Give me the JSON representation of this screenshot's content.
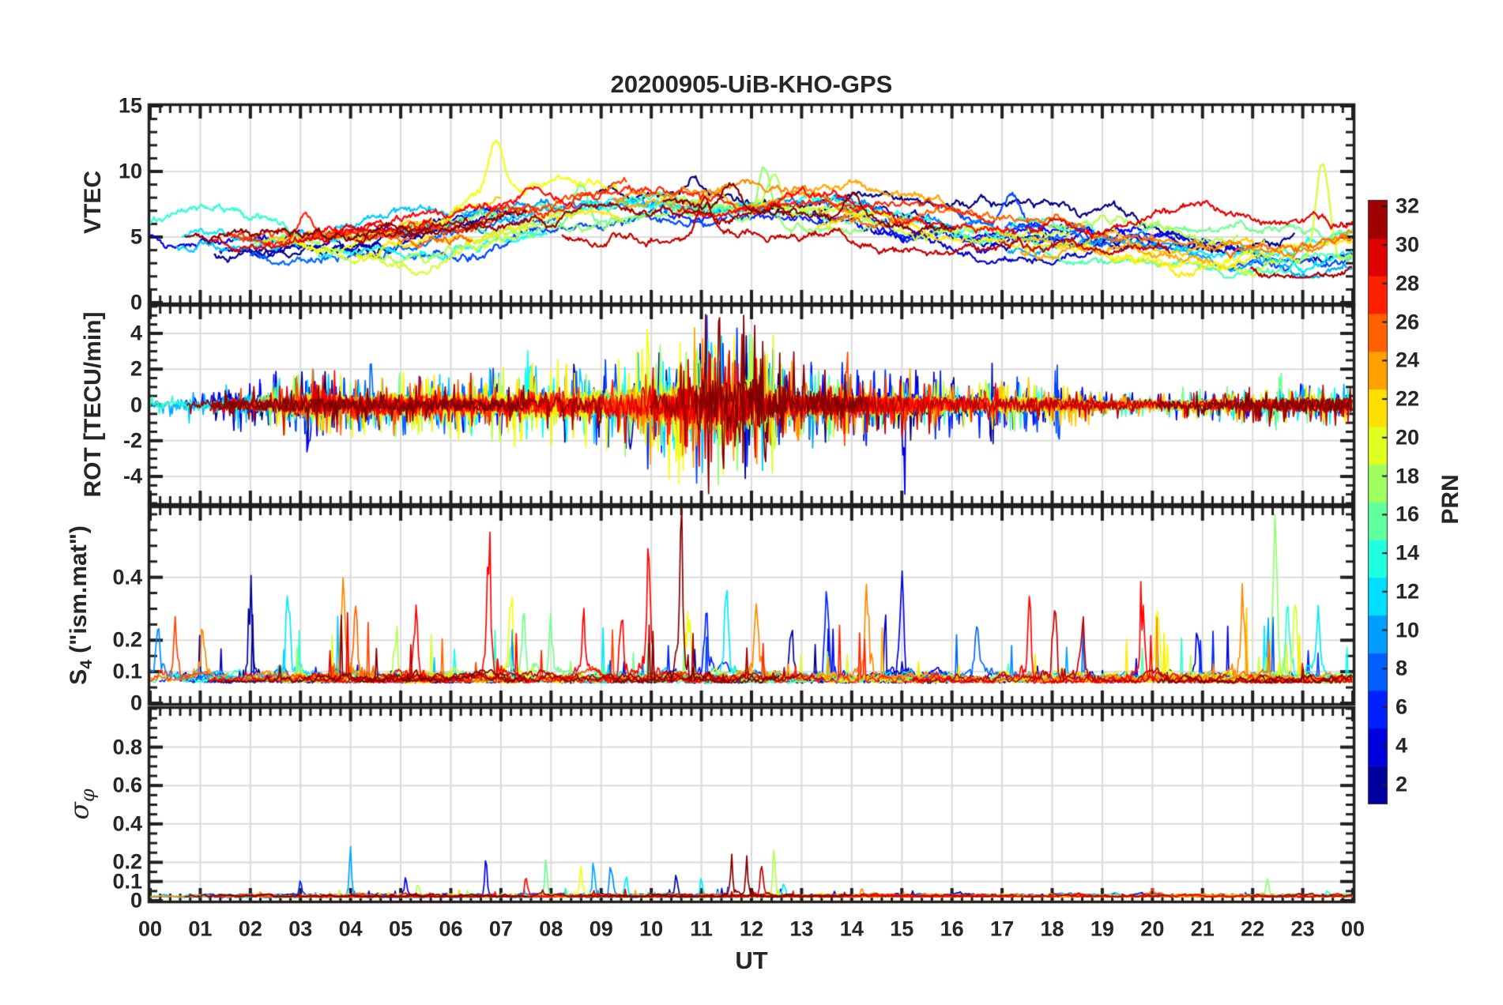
{
  "chart_data": {
    "type": "line",
    "title": "20200905-UiB-KHO-GPS",
    "xlabel": "UT",
    "x_axis": {
      "unit": "hours UT",
      "range": [
        0,
        24
      ],
      "tick_hours": [
        0,
        1,
        2,
        3,
        4,
        5,
        6,
        7,
        8,
        9,
        10,
        11,
        12,
        13,
        14,
        15,
        16,
        17,
        18,
        19,
        20,
        21,
        22,
        23,
        24
      ],
      "tick_labels": [
        "00",
        "01",
        "02",
        "03",
        "04",
        "05",
        "06",
        "07",
        "08",
        "09",
        "10",
        "11",
        "12",
        "13",
        "14",
        "15",
        "16",
        "17",
        "18",
        "19",
        "20",
        "21",
        "22",
        "23",
        "00"
      ],
      "minor_tick_step_hours": 0.2
    },
    "series_colormap": "jet",
    "prn_range": [
      1,
      32
    ],
    "grid_color": "#dbdbdb",
    "axis_color": "#1f1f1f",
    "panels": [
      {
        "id": "vtec",
        "ylabel": "VTEC",
        "ylim": [
          0,
          15
        ],
        "yticks": [
          0,
          5,
          10,
          15
        ],
        "ytick_labels": [
          "0",
          "5",
          "10",
          "15"
        ],
        "grid_y": [
          5,
          10
        ],
        "hourly_mean": [
          4.3,
          4.1,
          3.9,
          4.2,
          4.4,
          4.8,
          5.3,
          6.0,
          6.6,
          7.0,
          7.2,
          7.1,
          7.2,
          7.0,
          6.8,
          6.2,
          5.6,
          5.2,
          4.8,
          4.5,
          4.3,
          4.2,
          4.1,
          4.0,
          4.3
        ],
        "band_halfwidth": 1.3,
        "events": [
          [
            3.1,
            27,
            7.7
          ],
          [
            6.9,
            20,
            10.6
          ],
          [
            8.6,
            16,
            8.9
          ],
          [
            10.85,
            1,
            9.7
          ],
          [
            11.05,
            30,
            8.9
          ],
          [
            11.6,
            32,
            9.1
          ],
          [
            12.25,
            17,
            11.0
          ],
          [
            12.45,
            18,
            10.4
          ],
          [
            14.0,
            32,
            8.6
          ],
          [
            17.2,
            7,
            8.3
          ],
          [
            23.4,
            19,
            10.4
          ]
        ],
        "description": "Vertical TEC per GPS PRN; arcs cluster 3-5 TECU at night, rise to 7-8 TECU 08-14 UT, isolated peaks to 10-11 TECU near 07, 12.3 and 23.4 UT."
      },
      {
        "id": "rot",
        "ylabel": "ROT [TECU/min]",
        "ylim": [
          -5.5,
          5.5
        ],
        "yticks": [
          -4,
          -2,
          0,
          2,
          4
        ],
        "ytick_labels": [
          "-4",
          "-2",
          "0",
          "2",
          "4"
        ],
        "grid_y": [
          -4,
          -2,
          0,
          2,
          4
        ],
        "hourly_amplitude": [
          0.5,
          0.5,
          0.8,
          1.1,
          0.8,
          0.9,
          0.9,
          1.0,
          1.1,
          1.2,
          1.6,
          2.2,
          2.1,
          1.1,
          1.0,
          1.1,
          0.8,
          0.8,
          0.7,
          0.45,
          0.4,
          0.45,
          0.5,
          0.6,
          0.6
        ],
        "events": [
          [
            3.15,
            5,
            3.3
          ],
          [
            4.4,
            8,
            2.4
          ],
          [
            7.55,
            13,
            3.6
          ],
          [
            9.6,
            2,
            2.8
          ],
          [
            9.95,
            20,
            4.3
          ],
          [
            10.56,
            20,
            4.7
          ],
          [
            11.25,
            12,
            3.9
          ],
          [
            11.55,
            29,
            4.5
          ],
          [
            11.8,
            31,
            4.3
          ],
          [
            12.0,
            18,
            4.3
          ],
          [
            12.25,
            32,
            4.1
          ],
          [
            12.45,
            19,
            4.4
          ],
          [
            13.2,
            10,
            2.6
          ],
          [
            13.9,
            26,
            2.8
          ],
          [
            15.05,
            4,
            3.3
          ],
          [
            16.8,
            2,
            2.2
          ],
          [
            18.1,
            7,
            2.7
          ],
          [
            22.5,
            16,
            1.8
          ]
        ],
        "description": "Rate of TEC change; zero-mean noise +-0.5, strongest bursts to +-4.5 TECU/min between 10.5 and 12.5 UT (yellow, red, dark red PRNs)."
      },
      {
        "id": "s4",
        "ylabel_main": "S",
        "ylabel_sub": "4",
        "ylabel_rest": " (\"ism.mat\")",
        "ylim": [
          0,
          0.62
        ],
        "yticks": [
          0,
          0.1,
          0.2,
          0.4
        ],
        "ytick_labels": [
          "0",
          "0.1",
          "0.2",
          "0.4"
        ],
        "grid_y": [
          0.1,
          0.2,
          0.4
        ],
        "baseline": 0.07,
        "hourly_amplitude": [
          0.12,
          0.12,
          0.16,
          0.14,
          0.18,
          0.14,
          0.16,
          0.16,
          0.13,
          0.14,
          0.2,
          0.16,
          0.13,
          0.13,
          0.16,
          0.16,
          0.12,
          0.14,
          0.13,
          0.13,
          0.16,
          0.13,
          0.2,
          0.14,
          0.12
        ],
        "events": [
          [
            0.15,
            9,
            0.27
          ],
          [
            0.5,
            26,
            0.25
          ],
          [
            1.05,
            24,
            0.28
          ],
          [
            2.0,
            2,
            0.39
          ],
          [
            2.75,
            12,
            0.44
          ],
          [
            3.85,
            24,
            0.46
          ],
          [
            4.1,
            25,
            0.37
          ],
          [
            4.9,
            18,
            0.28
          ],
          [
            5.3,
            28,
            0.34
          ],
          [
            6.75,
            28,
            0.56
          ],
          [
            7.2,
            20,
            0.37
          ],
          [
            7.45,
            16,
            0.29
          ],
          [
            8.0,
            16,
            0.26
          ],
          [
            8.65,
            28,
            0.25
          ],
          [
            9.4,
            28,
            0.31
          ],
          [
            9.95,
            28,
            0.57
          ],
          [
            10.6,
            32,
            0.6
          ],
          [
            10.75,
            20,
            0.31
          ],
          [
            11.1,
            6,
            0.31
          ],
          [
            11.5,
            12,
            0.36
          ],
          [
            12.1,
            24,
            0.28
          ],
          [
            12.8,
            2,
            0.26
          ],
          [
            13.5,
            6,
            0.36
          ],
          [
            14.3,
            24,
            0.46
          ],
          [
            15.0,
            4,
            0.47
          ],
          [
            16.5,
            8,
            0.28
          ],
          [
            17.55,
            28,
            0.34
          ],
          [
            18.05,
            30,
            0.38
          ],
          [
            18.6,
            30,
            0.3
          ],
          [
            19.8,
            28,
            0.33
          ],
          [
            20.1,
            20,
            0.29
          ],
          [
            20.9,
            4,
            0.24
          ],
          [
            21.8,
            24,
            0.37
          ],
          [
            22.45,
            17,
            0.66
          ],
          [
            22.7,
            14,
            0.35
          ],
          [
            22.85,
            19,
            0.34
          ],
          [
            23.3,
            12,
            0.28
          ]
        ],
        "description": "Amplitude scintillation index S4; baseline 0.05-0.1 with frequent spikes 0.2-0.6, tallest near 10.6 UT (dark red) and 22.45 UT (light green, reaches panel top)."
      },
      {
        "id": "sigma_phi",
        "ylabel_main": "σ",
        "ylabel_sub": "φ",
        "ylim": [
          0,
          1.0
        ],
        "yticks": [
          0,
          0.1,
          0.2,
          0.4,
          0.6,
          0.8
        ],
        "ytick_labels": [
          "0",
          "0.1",
          "0.2",
          "0.4",
          "0.6",
          "0.8"
        ],
        "grid_y": [
          0.1,
          0.2,
          0.4,
          0.6,
          0.8
        ],
        "baseline": 0.02,
        "hourly_amplitude": [
          0.02,
          0.02,
          0.03,
          0.04,
          0.06,
          0.04,
          0.05,
          0.05,
          0.06,
          0.07,
          0.05,
          0.08,
          0.08,
          0.04,
          0.03,
          0.03,
          0.03,
          0.02,
          0.02,
          0.02,
          0.02,
          0.02,
          0.03,
          0.02,
          0.02
        ],
        "events": [
          [
            3.0,
            6,
            0.09
          ],
          [
            4.0,
            10,
            0.28
          ],
          [
            5.1,
            4,
            0.12
          ],
          [
            5.35,
            18,
            0.1
          ],
          [
            6.7,
            4,
            0.2
          ],
          [
            7.5,
            28,
            0.13
          ],
          [
            7.9,
            16,
            0.19
          ],
          [
            8.6,
            20,
            0.2
          ],
          [
            8.85,
            10,
            0.21
          ],
          [
            9.2,
            9,
            0.23
          ],
          [
            9.5,
            12,
            0.14
          ],
          [
            10.5,
            2,
            0.15
          ],
          [
            11.0,
            12,
            0.12
          ],
          [
            11.6,
            32,
            0.24
          ],
          [
            11.9,
            32,
            0.23
          ],
          [
            12.2,
            30,
            0.2
          ],
          [
            12.45,
            18,
            0.26
          ],
          [
            12.65,
            12,
            0.1
          ],
          [
            14.2,
            24,
            0.06
          ],
          [
            20.0,
            26,
            0.05
          ],
          [
            22.3,
            17,
            0.13
          ],
          [
            23.5,
            14,
            0.06
          ]
        ],
        "description": "Phase scintillation sigma-phi; flat near 0.02 with spikes below 0.3, largest 0.28 at 04 UT (light blue) and 0.22-0.26 between 11.5 and 12.5 UT."
      }
    ],
    "colorbar": {
      "label": "PRN",
      "ticks": [
        2,
        4,
        6,
        8,
        10,
        12,
        14,
        16,
        18,
        20,
        22,
        24,
        26,
        28,
        30,
        32
      ],
      "tick_labels": [
        "2",
        "4",
        "6",
        "8",
        "10",
        "12",
        "14",
        "16",
        "18",
        "20",
        "22",
        "24",
        "26",
        "28",
        "30",
        "32"
      ],
      "levels": 16,
      "range": [
        1,
        32.3
      ]
    }
  }
}
